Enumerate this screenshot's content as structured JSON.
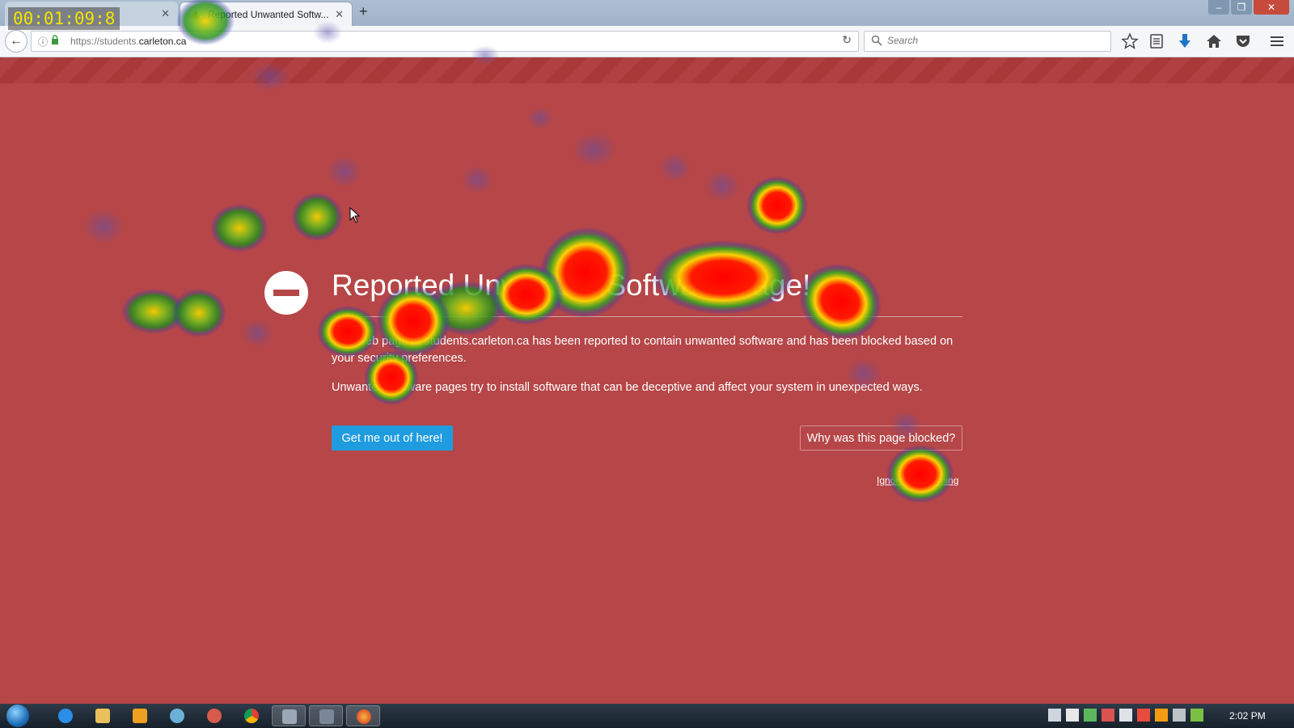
{
  "browser": {
    "tabs": [
      {
        "label": "",
        "active": false
      },
      {
        "label": "Reported Unwanted Softw...",
        "active": true
      }
    ],
    "new_tab": "+",
    "url_prefix": "https://students.",
    "url_domain": "carleton.ca",
    "search_placeholder": "Search",
    "window_controls": [
      "–",
      "❐",
      "✕"
    ]
  },
  "page": {
    "title": "Reported Unwanted Software Page!",
    "paragraph1": "This web page at students.carleton.ca has been reported to contain unwanted software and has been blocked based on your security preferences.",
    "paragraph2": "Unwanted software pages try to install software that can be deceptive and affect your system in unexpected ways.",
    "primary_button": "Get me out of here!",
    "secondary_button": "Why was this page blocked?",
    "ignore_link": "Ignore this warning",
    "background_color": "#b64647",
    "button_color": "#1f9ce0"
  },
  "overlay": {
    "timer": "00:01:09:8"
  },
  "taskbar": {
    "clock": "2:02 PM",
    "apps": [
      "internet-explorer",
      "file-explorer",
      "media-player",
      "paint",
      "app",
      "chrome",
      "app",
      "app",
      "firefox"
    ]
  }
}
